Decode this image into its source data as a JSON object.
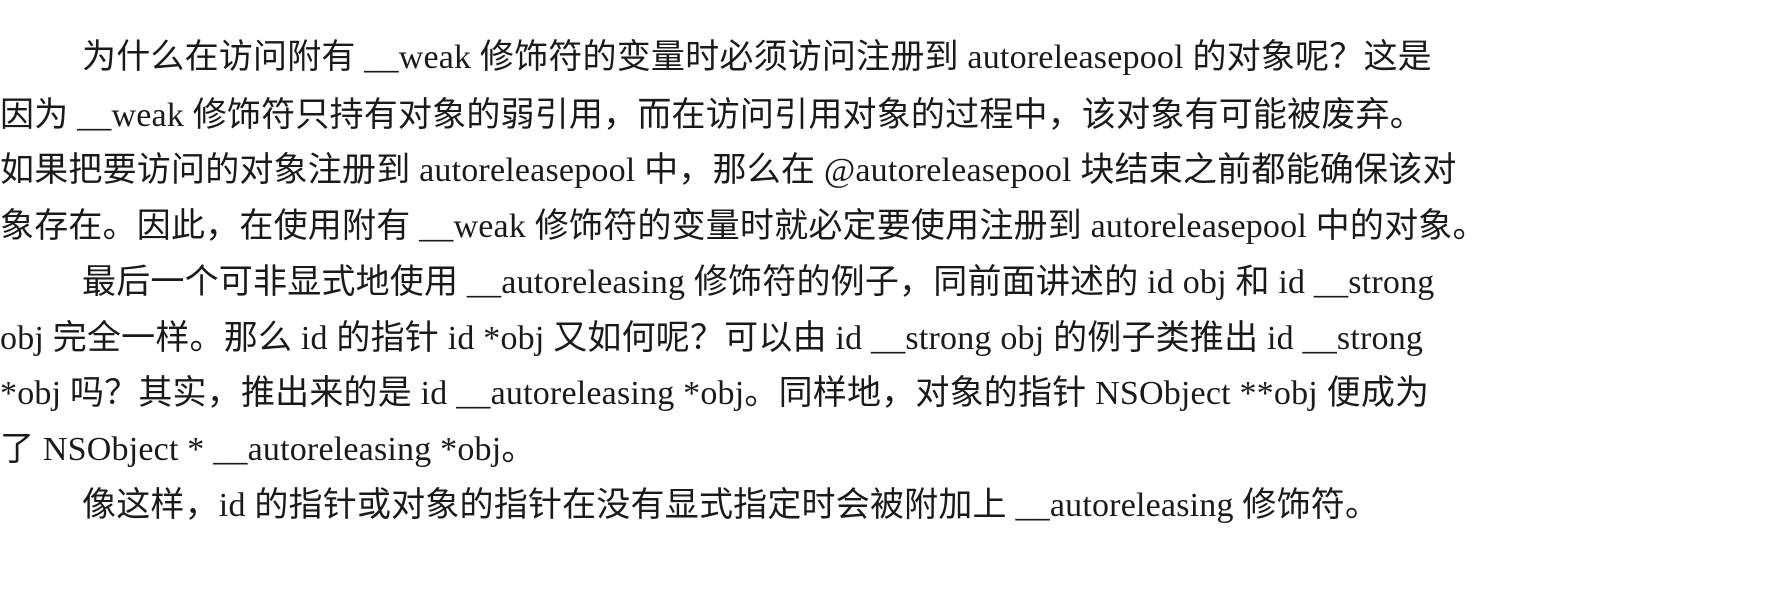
{
  "paragraphs": [
    {
      "lines": [
        "为什么在访问附有 __weak 修饰符的变量时必须访问注册到 autoreleasepool 的对象呢？这是",
        "因为 __weak 修饰符只持有对象的弱引用，而在访问引用对象的过程中，该对象有可能被废弃。",
        "如果把要访问的对象注册到 autoreleasepool 中，那么在 @autoreleasepool 块结束之前都能确保该对",
        "象存在。因此，在使用附有 __weak 修饰符的变量时就必定要使用注册到 autoreleasepool 中的对象。"
      ]
    },
    {
      "lines": [
        "最后一个可非显式地使用 __autoreleasing 修饰符的例子，同前面讲述的 id obj 和 id __strong",
        "obj 完全一样。那么 id 的指针 id *obj 又如何呢？可以由 id __strong obj 的例子类推出 id __strong",
        "*obj 吗？其实，推出来的是 id __autoreleasing *obj。同样地，对象的指针 NSObject **obj 便成为",
        "了 NSObject * __autoreleasing *obj。"
      ]
    },
    {
      "lines": [
        "像这样，id 的指针或对象的指针在没有显式指定时会被附加上 __autoreleasing 修饰符。"
      ]
    }
  ]
}
